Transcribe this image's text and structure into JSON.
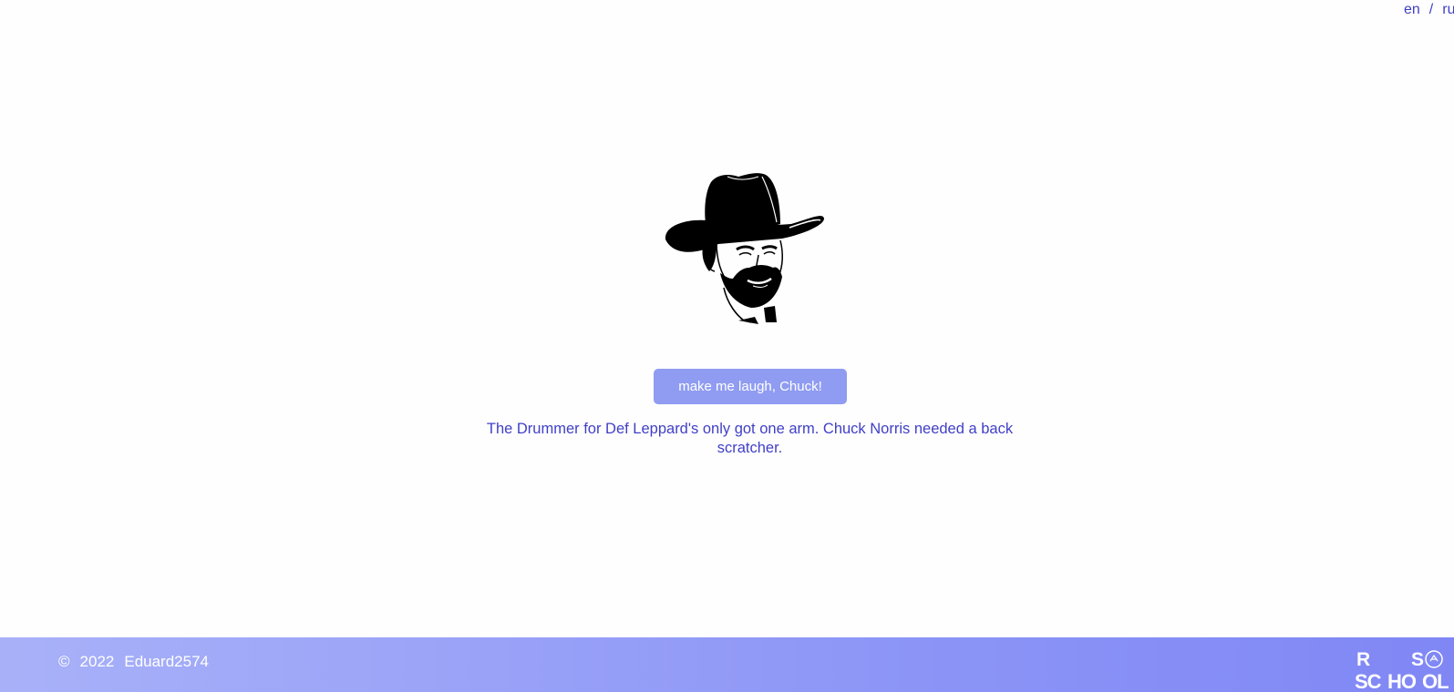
{
  "lang": {
    "en": "en",
    "separator": "/",
    "ru": "ru"
  },
  "hero": {
    "image_alt": "chuck-norris-portrait"
  },
  "button": {
    "label": "make me laugh, Chuck!"
  },
  "joke": {
    "text": "The Drummer for Def Leppard's only got one arm. Chuck Norris needed a back scratcher."
  },
  "footer": {
    "copyright_symbol": "©",
    "year": "2022",
    "author": "Eduard2574",
    "logo_text": "RS SCHOOL"
  },
  "colors": {
    "accent": "#3f3fc7",
    "button": "#8f9cf2",
    "footer_start": "#a8b1f8",
    "footer_end": "#8087f5"
  }
}
